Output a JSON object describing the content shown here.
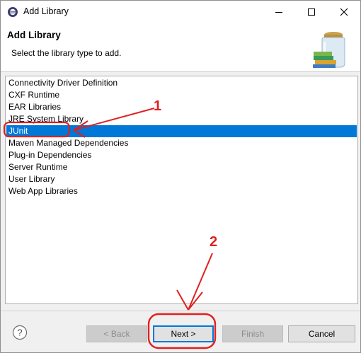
{
  "window": {
    "title": "Add Library"
  },
  "header": {
    "heading": "Add Library",
    "subtitle": "Select the library type to add."
  },
  "library_types": [
    {
      "label": "Connectivity Driver Definition",
      "selected": false
    },
    {
      "label": "CXF Runtime",
      "selected": false
    },
    {
      "label": "EAR Libraries",
      "selected": false
    },
    {
      "label": "JRE System Library",
      "selected": false
    },
    {
      "label": "JUnit",
      "selected": true
    },
    {
      "label": "Maven Managed Dependencies",
      "selected": false
    },
    {
      "label": "Plug-in Dependencies",
      "selected": false
    },
    {
      "label": "Server Runtime",
      "selected": false
    },
    {
      "label": "User Library",
      "selected": false
    },
    {
      "label": "Web App Libraries",
      "selected": false
    }
  ],
  "buttons": {
    "back": "< Back",
    "next": "Next >",
    "finish": "Finish",
    "cancel": "Cancel"
  },
  "annotations": {
    "step1": "1",
    "step2": "2",
    "color": "#e02020"
  },
  "colors": {
    "selection": "#0078d7"
  },
  "icons": {
    "app": "eclipse-icon",
    "header": "library-jar-icon",
    "help": "help-icon"
  }
}
